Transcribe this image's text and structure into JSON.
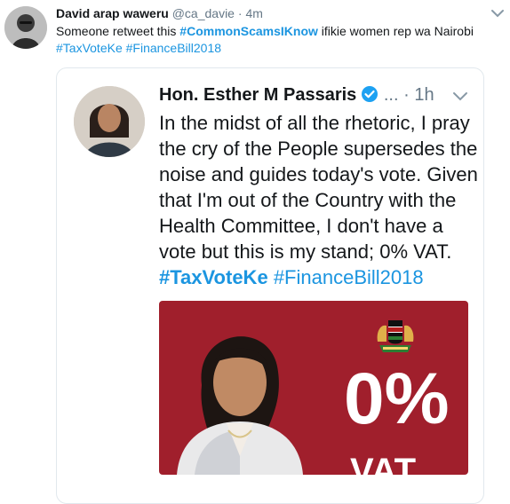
{
  "tweet": {
    "author_name": "David arap waweru",
    "handle": "@ca_davie",
    "separator": "·",
    "time": "4m",
    "text_before": "Someone retweet this ",
    "hashtag_main": "#CommonScamsIKnow",
    "text_after": " ifikie women rep wa Nairobi",
    "hashtag_1": "#TaxVoteKe",
    "hashtag_2": "#FinanceBill2018",
    "avatar_icon": "person-avatar-icon",
    "menu_icon": "chevron-down-icon"
  },
  "quoted_tweet": {
    "author_name": "Hon. Esther M Passaris",
    "ellipsis": "...",
    "separator": "·",
    "time": "1h",
    "text": "In the midst of all the rhetoric, I pray the cry of the People supersedes the noise and guides today's vote. Given that I'm out of the Country with the Health Committee, I don't have a vote but this is my stand; 0% VAT. ",
    "hashtag_1": "#TaxVoteKe",
    "hashtag_2": "#FinanceBill2018",
    "verified_icon": "verified-badge-icon",
    "menu_icon": "chevron-down-icon",
    "media": {
      "big_text": "0%",
      "sub_text": "VAT",
      "background_color": "#a01f2c",
      "emblem_icon": "kenya-coat-of-arms-icon"
    }
  },
  "colors": {
    "link": "#1b95e0",
    "text": "#14171a",
    "muted": "#657786",
    "border": "#e1e8ed"
  }
}
